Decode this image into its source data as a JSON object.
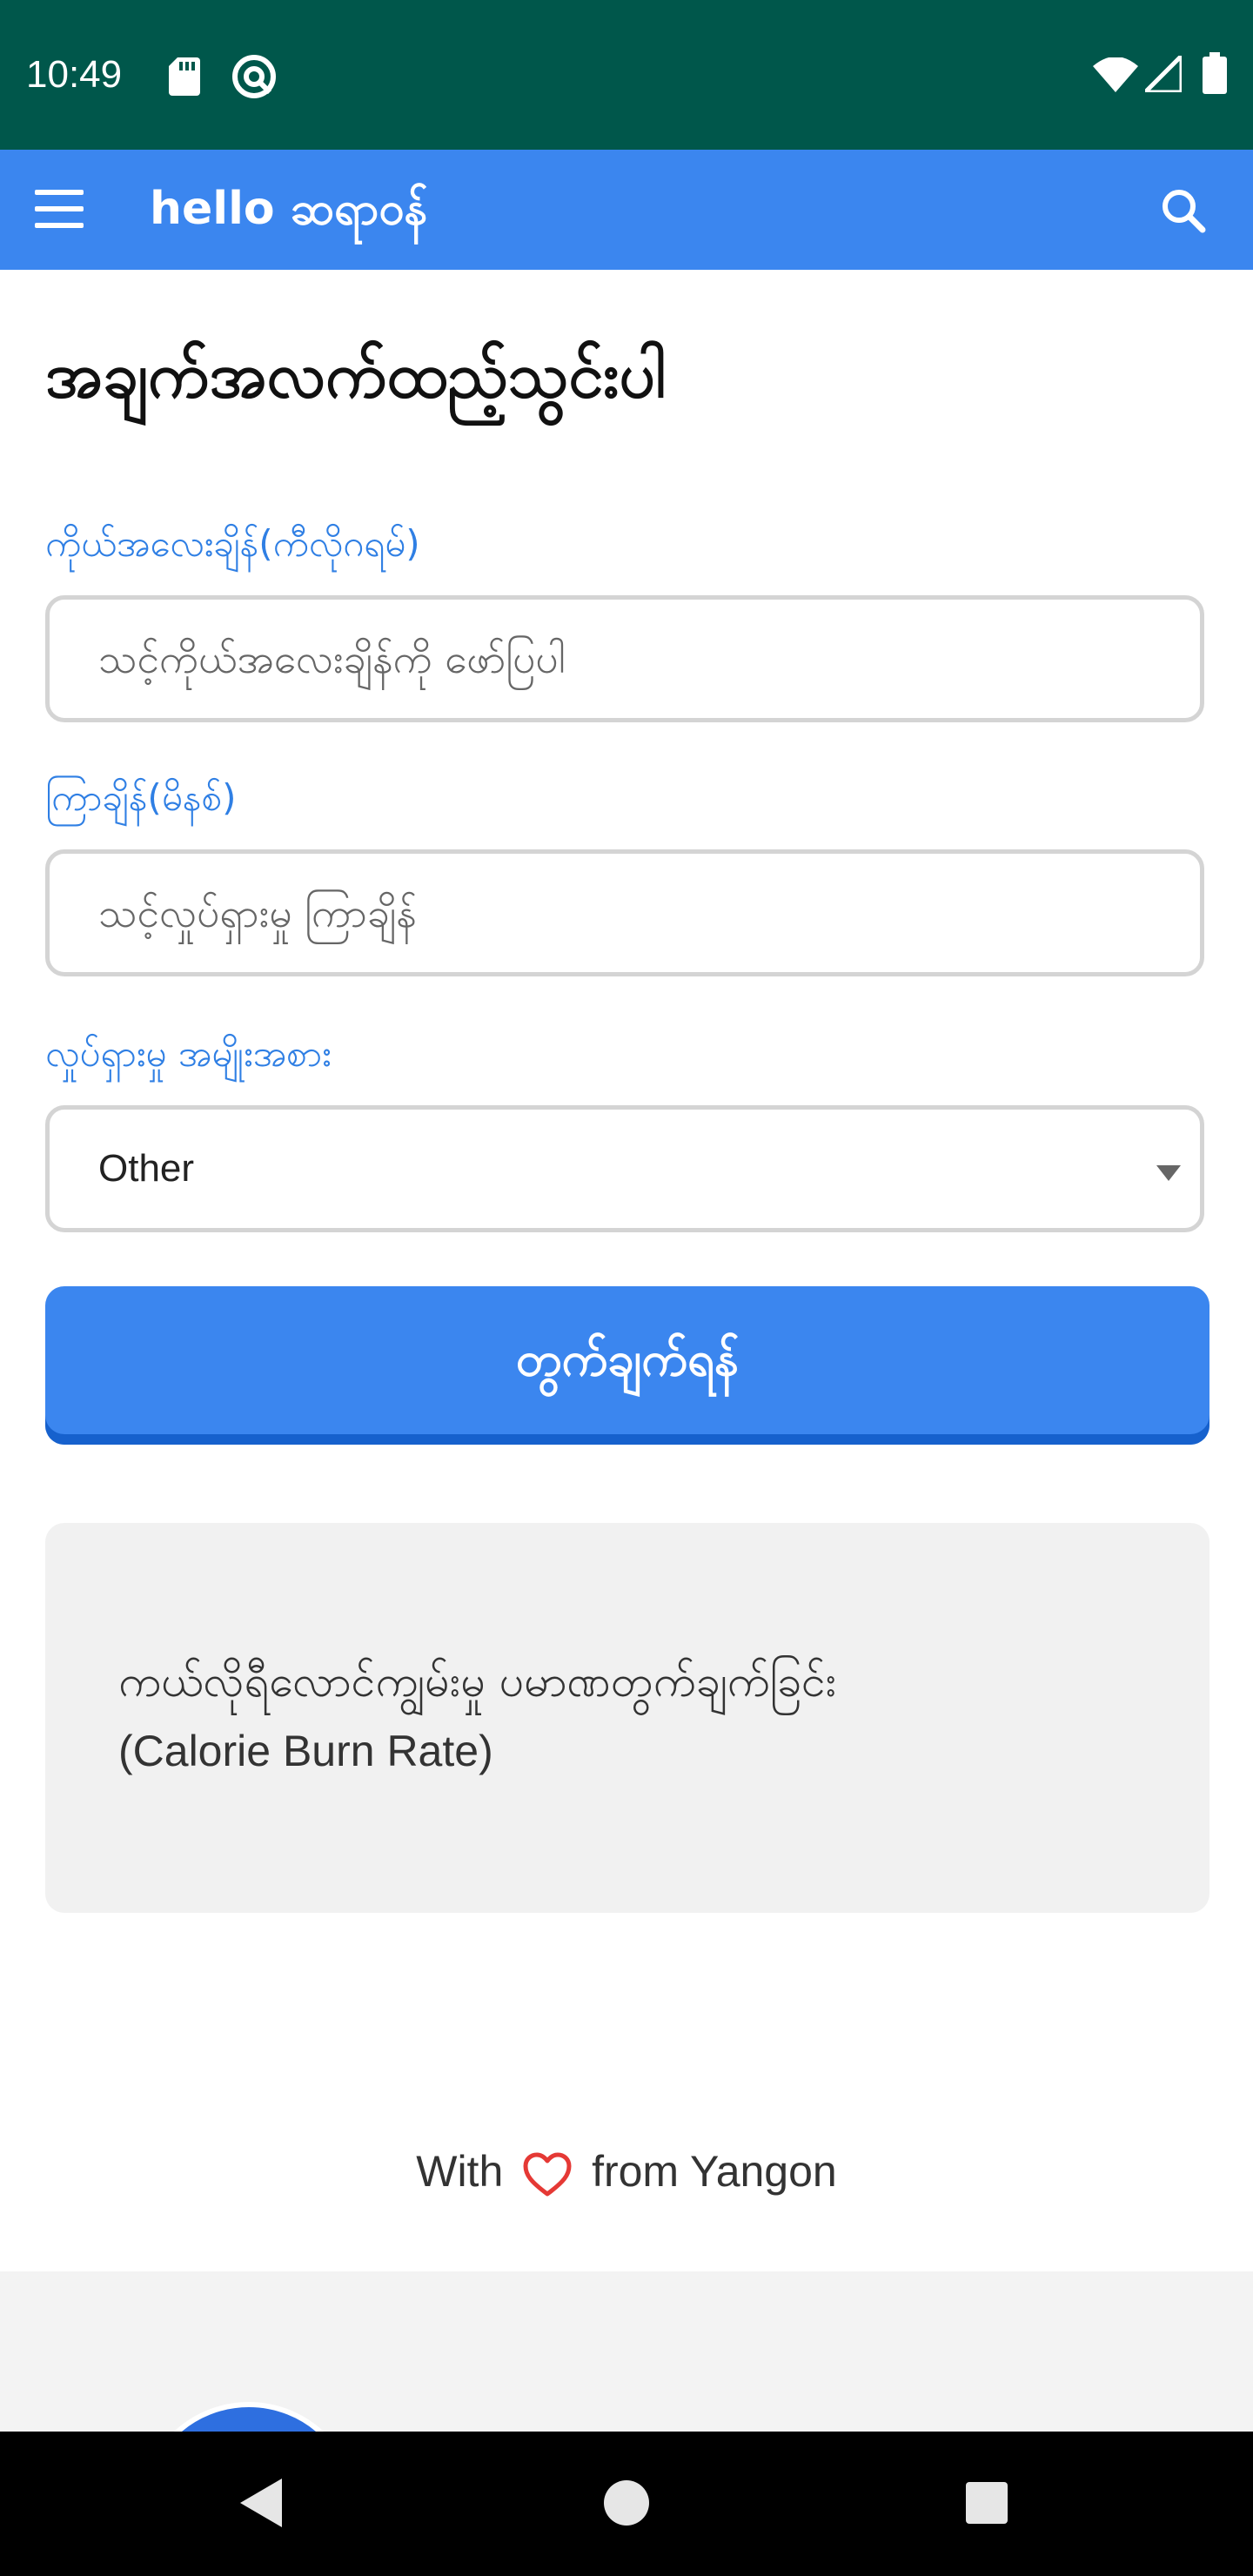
{
  "status_bar": {
    "time": "10:49",
    "icons": [
      "sd-card-icon",
      "sync-icon",
      "wifi-icon",
      "signal-icon",
      "battery-icon"
    ]
  },
  "app_bar": {
    "brand": "hello ဆရာဝန်",
    "icons": [
      "menu-icon",
      "search-icon"
    ],
    "color": "#3b86ef"
  },
  "form": {
    "title": "အချက်အလက်ထည့်သွင်းပါ",
    "weight_label": "ကိုယ်အလေးချိန်(ကီလိုဂရမ်)",
    "weight_placeholder": "သင့်ကိုယ်အလေးချိန်ကို ဖော်ပြပါ",
    "duration_label": "ကြာချိန်(မိနစ်)",
    "duration_placeholder": "သင့်လှုပ်ရှားမှု ကြာချိန်",
    "activity_label": "လှုပ်ရှားမှု အမျိုးအစား",
    "activity_value": "Other",
    "calculate_label": "တွက်ချက်ရန်"
  },
  "result": {
    "line1": "ကယ်လိုရီလောင်ကျွမ်းမှု ပမာဏတွက်ချက်ခြင်း",
    "line2": "(Calorie Burn Rate)"
  },
  "footer": {
    "prefix": "With",
    "suffix": "from Yangon",
    "heart_color": "#e53935"
  },
  "nav_bar": {
    "icons": [
      "back-icon",
      "home-icon",
      "recents-icon"
    ]
  }
}
